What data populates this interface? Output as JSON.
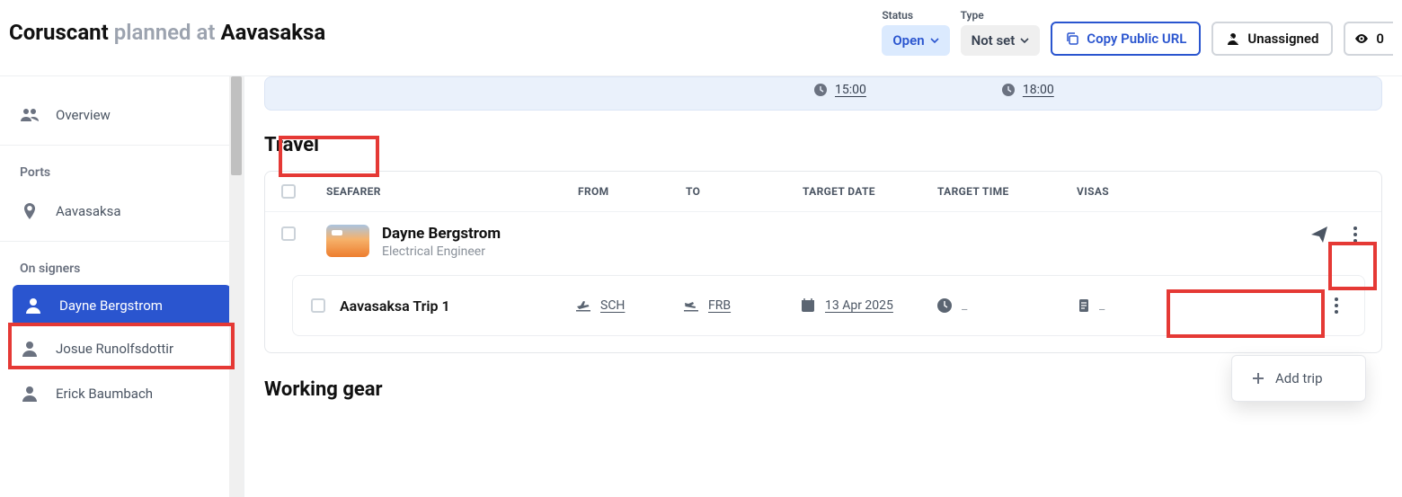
{
  "header": {
    "vessel": "Coruscant",
    "action": "planned at",
    "port": "Aavasaksa",
    "status_label": "Status",
    "status_value": "Open",
    "type_label": "Type",
    "type_value": "Not set",
    "copy_url_label": "Copy Public URL",
    "assignee_label": "Unassigned",
    "watch_count": "0"
  },
  "sidebar": {
    "overview_label": "Overview",
    "ports_label": "Ports",
    "ports": [
      {
        "label": "Aavasaksa"
      }
    ],
    "on_signers_label": "On signers",
    "on_signers": [
      {
        "label": "Dayne Bergstrom",
        "active": true
      },
      {
        "label": "Josue Runolfsdottir"
      },
      {
        "label": "Erick Baumbach"
      }
    ]
  },
  "times": {
    "t1": "15:00",
    "t2": "18:00"
  },
  "travel": {
    "section_title": "Travel",
    "cols": {
      "seafarer": "SEAFARER",
      "from": "FROM",
      "to": "TO",
      "target_date": "TARGET DATE",
      "target_time": "TARGET TIME",
      "visas": "VISAS"
    },
    "seafarer": {
      "name": "Dayne Bergstrom",
      "role": "Electrical Engineer"
    },
    "trip": {
      "name": "Aavasaksa Trip 1",
      "from": "SCH",
      "to": "FRB",
      "date": "13 Apr 2025",
      "time": "_",
      "visas": "_"
    }
  },
  "dropdown": {
    "add_trip": "Add trip"
  },
  "working_gear_title": "Working gear"
}
